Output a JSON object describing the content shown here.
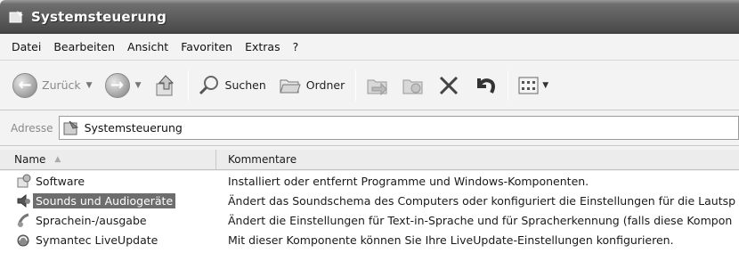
{
  "window": {
    "title": "Systemsteuerung"
  },
  "menu": [
    "Datei",
    "Bearbeiten",
    "Ansicht",
    "Favoriten",
    "Extras",
    "?"
  ],
  "toolbar": {
    "back_label": "Zurück",
    "search_label": "Suchen",
    "folders_label": "Ordner"
  },
  "address": {
    "label": "Adresse",
    "value": "Systemsteuerung"
  },
  "columns": {
    "name": "Name",
    "comments": "Kommentare"
  },
  "rows": [
    {
      "name": "Software",
      "comment": "Installiert oder entfernt Programme und Windows-Komponenten.",
      "icon": "software-icon"
    },
    {
      "name": "Sounds und Audiogeräte",
      "comment": "Ändert das Soundschema des Computers oder konfiguriert die Einstellungen für die Lautsp",
      "icon": "speaker-icon",
      "selected": true
    },
    {
      "name": "Sprachein-/ausgabe",
      "comment": "Ändert die Einstellungen für Text-in-Sprache und für Spracherkennung (falls diese Kompon",
      "icon": "speech-icon"
    },
    {
      "name": "Symantec LiveUpdate",
      "comment": "Mit dieser Komponente können Sie Ihre LiveUpdate-Einstellungen konfigurieren.",
      "icon": "liveupdate-icon"
    }
  ]
}
